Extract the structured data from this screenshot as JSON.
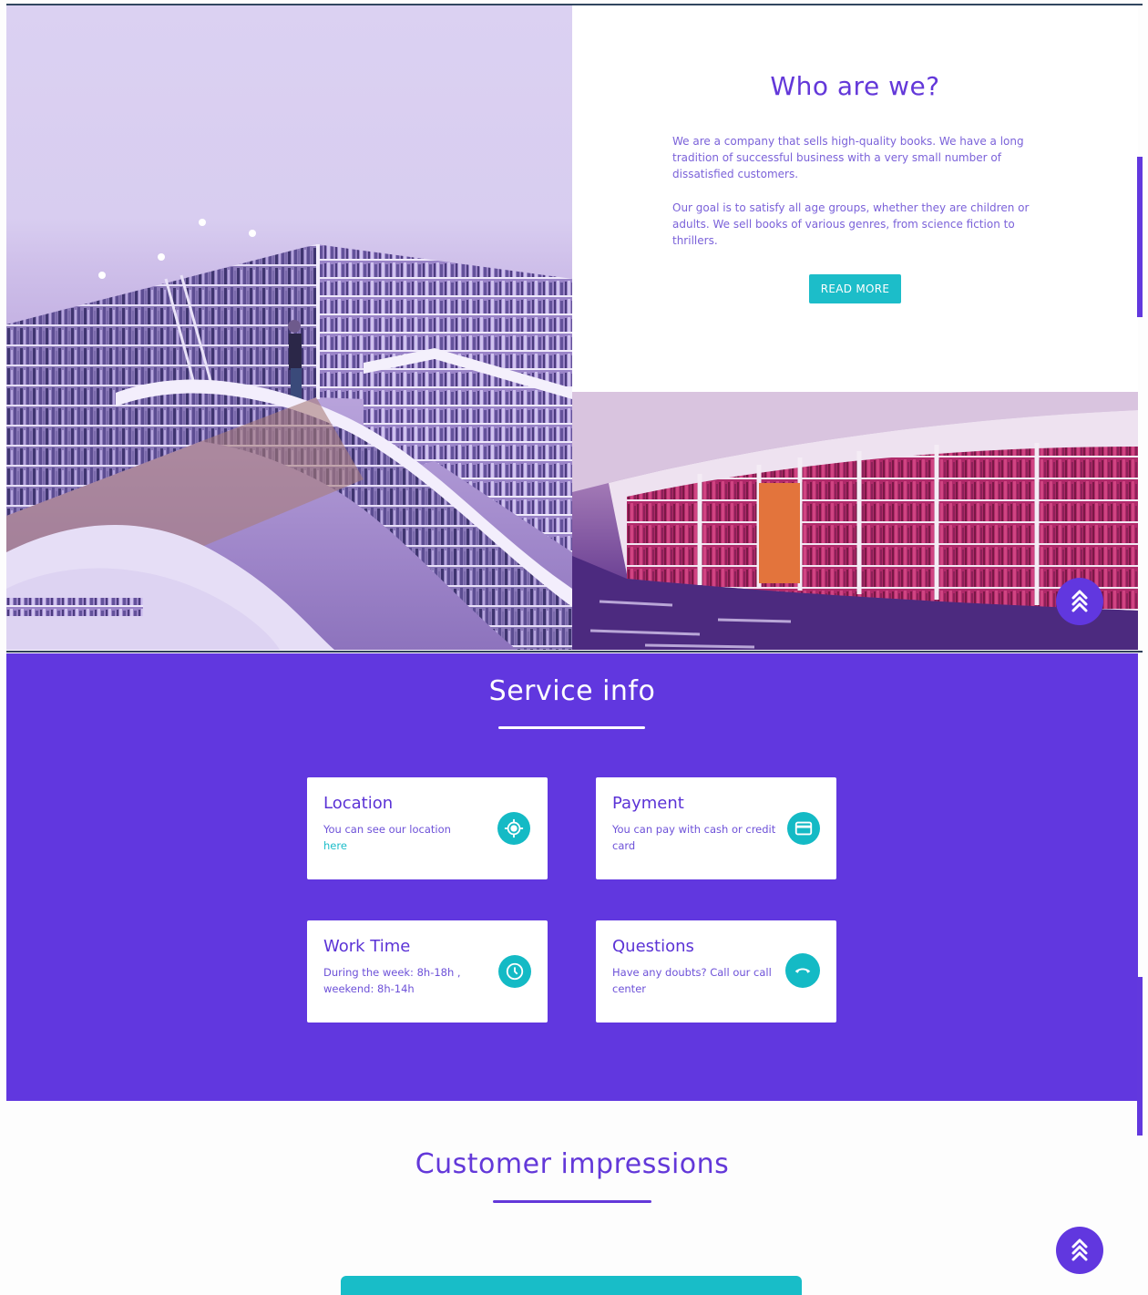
{
  "about": {
    "title": "Who are we?",
    "paragraph_1": "We are a company that sells high-quality books. We have a long tradition of successful business with a very small number of dissatisfied customers.",
    "paragraph_2": "Our goal is to satisfy all age groups, whether they are children or adults. We sell books of various genres, from science fiction to thrillers.",
    "read_more_label": "READ MORE",
    "images": [
      "library-bookshelves-photo",
      "library-red-books-photo"
    ]
  },
  "service": {
    "title": "Service info",
    "cards": [
      {
        "title": "Location",
        "text": "You can see our location",
        "link_text": "here",
        "icon": "location-target-icon"
      },
      {
        "title": "Payment",
        "text": "You can pay with cash or credit card",
        "icon": "credit-card-icon"
      },
      {
        "title": "Work Time",
        "text": "During the week: 8h-18h , weekend: 8h-14h",
        "icon": "clock-icon"
      },
      {
        "title": "Questions",
        "text": "Have any doubts? Call our call center",
        "icon": "phone-icon"
      }
    ]
  },
  "impressions": {
    "title": "Customer impressions"
  },
  "icons": {
    "back_to_top": "double-chevron-up-icon"
  },
  "colors": {
    "primary": "#6137df",
    "accent": "#1cbdc9",
    "text": "#6338d9",
    "white": "#ffffff"
  }
}
